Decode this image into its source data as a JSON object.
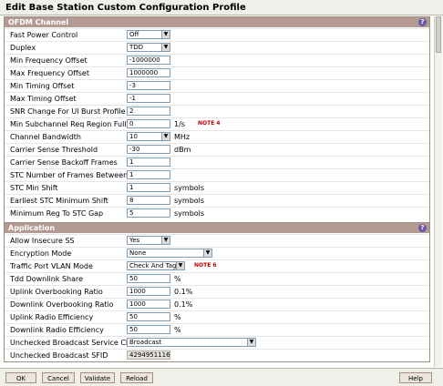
{
  "window": {
    "title": "Edit Base Station Custom Configuration Profile"
  },
  "ofdm": {
    "header": "OFDM Channel",
    "rows": [
      {
        "label": "Fast Power Control",
        "value": "Off",
        "type": "select",
        "w": 48
      },
      {
        "label": "Duplex",
        "value": "TDD",
        "type": "select",
        "w": 48
      },
      {
        "label": "Min Frequency Offset",
        "value": "-1000000",
        "type": "input",
        "w": 48
      },
      {
        "label": "Max Frequency Offset",
        "value": "1000000",
        "type": "input",
        "w": 48
      },
      {
        "label": "Min Timing Offset",
        "value": "-3",
        "type": "input",
        "w": 48
      },
      {
        "label": "Max Timing Offset",
        "value": "-1",
        "type": "input",
        "w": 48
      },
      {
        "label": "SNR Change For Ul Burst Profile",
        "value": "2",
        "type": "input",
        "w": 48
      },
      {
        "label": "Min Subchannel Req Region Full Tx Opp",
        "value": "0",
        "type": "input",
        "w": 48,
        "unit": "1/s",
        "note": "NOTE 4"
      },
      {
        "label": "Channel Bandwidth",
        "value": "10",
        "type": "select",
        "w": 48,
        "unit": "MHz"
      },
      {
        "label": "Carrier Sense Threshold",
        "value": "-30",
        "type": "input",
        "w": 48,
        "unit": "dBm"
      },
      {
        "label": "Carrier Sense Backoff Frames",
        "value": "1",
        "type": "input",
        "w": 48
      },
      {
        "label": "STC Number of Frames Between Shifts",
        "value": "1",
        "type": "input",
        "w": 48
      },
      {
        "label": "STC Min Shift",
        "value": "1",
        "type": "input",
        "w": 48,
        "unit": "symbols"
      },
      {
        "label": "Earliest STC Minimum Shift",
        "value": "8",
        "type": "input",
        "w": 48,
        "unit": "symbols"
      },
      {
        "label": "Minimum Reg To STC Gap",
        "value": "5",
        "type": "input",
        "w": 48,
        "unit": "symbols"
      }
    ]
  },
  "application": {
    "header": "Application",
    "rows": [
      {
        "label": "Allow Insecure SS",
        "value": "Yes",
        "type": "select",
        "w": 48
      },
      {
        "label": "Encryption Mode",
        "value": "None",
        "type": "select",
        "w": 94
      },
      {
        "label": "Traffic Port VLAN Mode",
        "value": "Check And Tag",
        "type": "select",
        "w": 64,
        "note": "NOTE 6"
      },
      {
        "label": "Tdd Downlink Share",
        "value": "50",
        "type": "input",
        "w": 48,
        "unit": "%"
      },
      {
        "label": "Uplink Overbooking Ratio",
        "value": "1000",
        "type": "input",
        "w": 48,
        "unit": "0.1%"
      },
      {
        "label": "Downlink Overbooking Ratio",
        "value": "1000",
        "type": "input",
        "w": 48,
        "unit": "0.1%"
      },
      {
        "label": "Uplink Radio Efficiency",
        "value": "50",
        "type": "input",
        "w": 48,
        "unit": "%"
      },
      {
        "label": "Downlink Radio Efficiency",
        "value": "50",
        "type": "input",
        "w": 48,
        "unit": "%"
      },
      {
        "label": "Unchecked Broadcast Service Class",
        "value": "Broadcast",
        "type": "select",
        "w": 142
      },
      {
        "label": "Unchecked Broadcast SFID",
        "value": "4294951116",
        "type": "readonly",
        "w": 48
      }
    ]
  },
  "footer": {
    "ok": "OK",
    "cancel": "Cancel",
    "validate": "Validate",
    "reload": "Reload",
    "help": "Help"
  }
}
